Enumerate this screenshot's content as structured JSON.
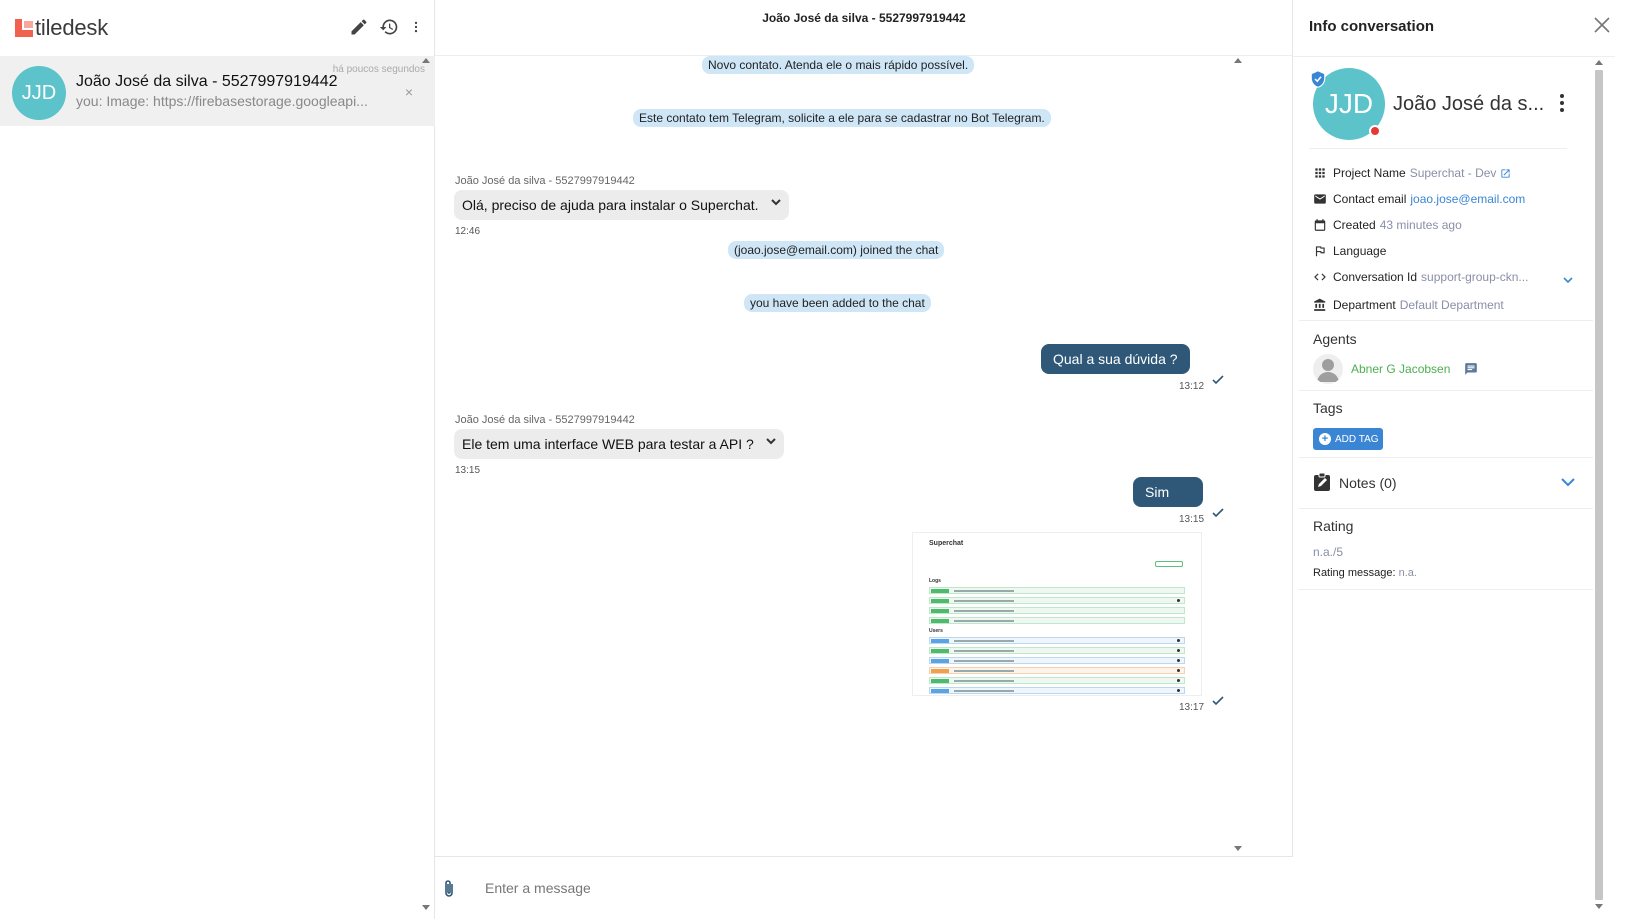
{
  "app": {
    "logo_text": "tiledesk"
  },
  "left_panel": {
    "conversation": {
      "avatar_initials": "JJD",
      "name": "João José da silva - 5527997919442",
      "preview": "you: Image: https://firebasestorage.googleapi...",
      "time": "há poucos segundos",
      "close_label": "×"
    }
  },
  "center": {
    "title": "João José da silva - 5527997919442",
    "system_messages": [
      "Novo contato. Atenda ele o mais rápido possível.",
      "Este contato tem Telegram, solicite a ele para se cadastrar no Bot Telegram.",
      "(joao.jose@email.com) joined the chat",
      "you have been added to the chat"
    ],
    "incoming": [
      {
        "sender": "João José da silva - 5527997919442",
        "text": "Olá, preciso de ajuda para instalar o Superchat.",
        "time": "12:46"
      },
      {
        "sender": "João José da silva - 5527997919442",
        "text": "Ele tem uma interface WEB para testar a API ?",
        "time": "13:15"
      }
    ],
    "outgoing": [
      {
        "text": "Qual a sua dúvida ?",
        "time": "13:12"
      },
      {
        "text": "Sim",
        "time": "13:15"
      }
    ],
    "image_message": {
      "time": "13:17",
      "preview_title": "Superchat",
      "preview_sections": [
        "Logs",
        "Users"
      ]
    },
    "composer": {
      "placeholder": "Enter a message"
    }
  },
  "right_panel": {
    "title": "Info conversation",
    "contact": {
      "initials": "JJD",
      "name": "João José da s..."
    },
    "info": {
      "project_label": "Project Name",
      "project_value": "Superchat - Dev",
      "email_label": "Contact email",
      "email_value": "joao.jose@email.com",
      "created_label": "Created",
      "created_value": "43 minutes ago",
      "language_label": "Language",
      "conv_id_label": "Conversation Id",
      "conv_id_value": "support-group-ckn...",
      "department_label": "Department",
      "department_value": "Default Department"
    },
    "agents": {
      "title": "Agents",
      "name": "Abner G Jacobsen"
    },
    "tags": {
      "title": "Tags",
      "add_label": "ADD TAG"
    },
    "notes": {
      "title": "Notes (0)"
    },
    "rating": {
      "title": "Rating",
      "value": "n.a./5",
      "message_label": "Rating message:",
      "message_value": "n.a."
    }
  },
  "colors": {
    "accent": "#3a86d4",
    "outgoing_bubble": "#2f5878",
    "system_bubble": "#cfe6f7",
    "avatar": "#5cc3ca",
    "agent_name": "#4caf50"
  }
}
